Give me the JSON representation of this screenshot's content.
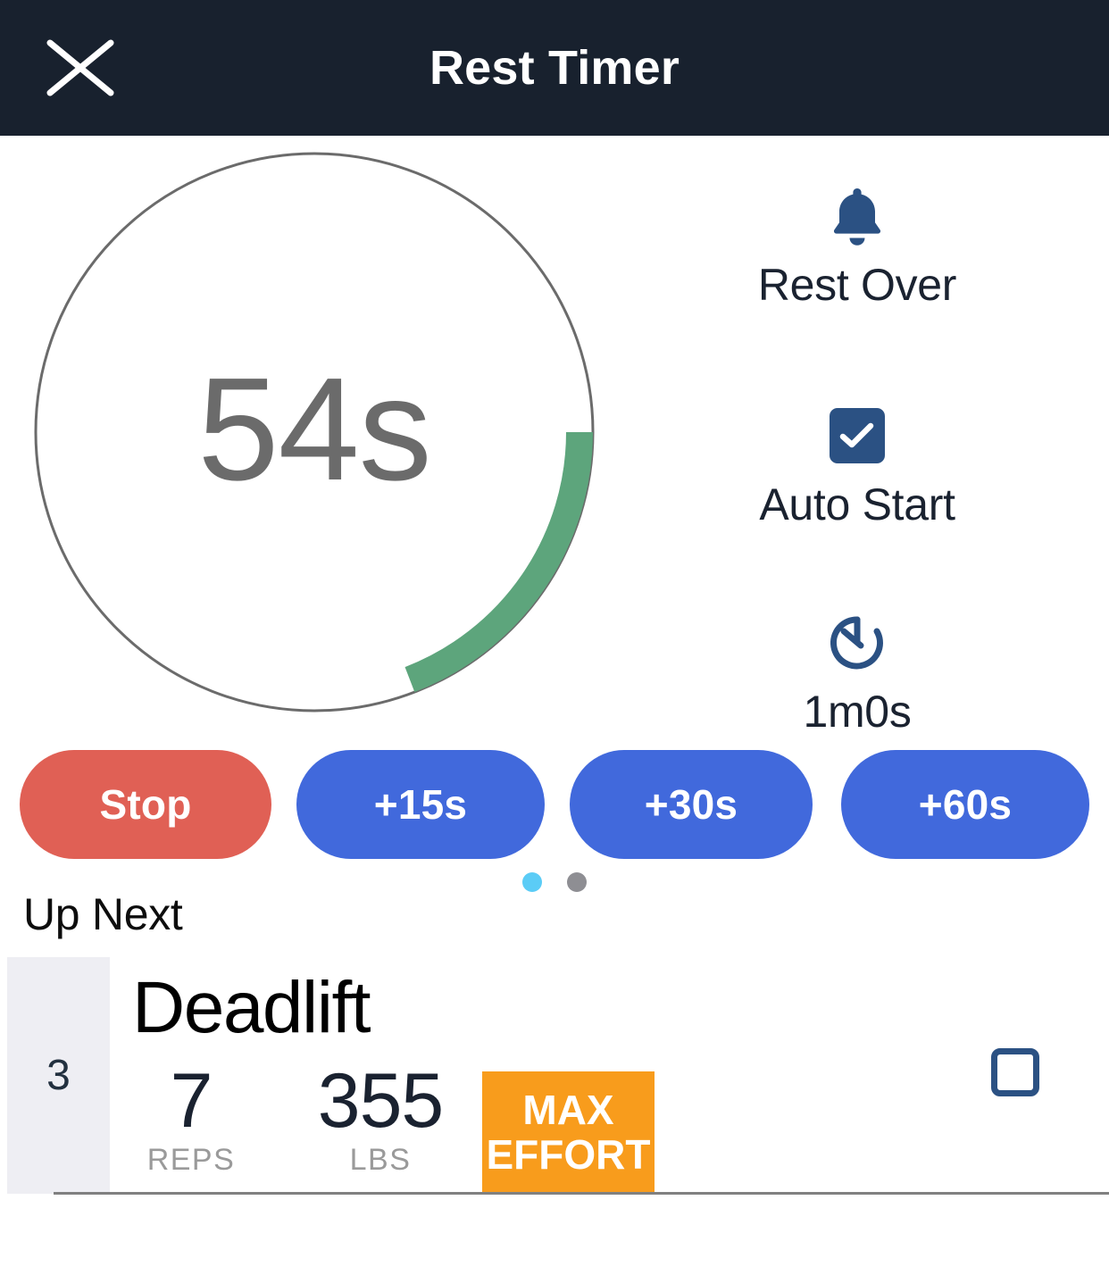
{
  "header": {
    "title": "Rest Timer",
    "close_icon": "close-icon"
  },
  "timer": {
    "remaining_label": "54s",
    "remaining_seconds": 54,
    "total_label": "1m0s",
    "total_seconds": 60,
    "progress_arc_color": "#5da57c",
    "track_color": "#6b6b6b",
    "arc_start_deg": 90,
    "arc_end_deg": 140
  },
  "side_panel": {
    "rest_over": {
      "icon": "bell-icon",
      "label": "Rest Over"
    },
    "auto_start": {
      "icon": "checkbox-checked-icon",
      "label": "Auto Start",
      "checked": true
    },
    "duration": {
      "icon": "stopwatch-icon",
      "label": "1m0s"
    }
  },
  "actions": {
    "buttons": [
      {
        "label": "Stop",
        "color": "#e06055"
      },
      {
        "label": "+15s",
        "color": "#4169dc"
      },
      {
        "label": "+30s",
        "color": "#4169dc"
      },
      {
        "label": "+60s",
        "color": "#4169dc"
      }
    ]
  },
  "pagination": {
    "dots": 2,
    "active_index": 0,
    "active_color": "#5bccf6",
    "inactive_color": "#8e8e93"
  },
  "up_next": {
    "section_label": "Up Next",
    "set": {
      "index": "3",
      "exercise": "Deadlift",
      "metrics": [
        {
          "value": "7",
          "unit": "REPS"
        },
        {
          "value": "355",
          "unit": "LBS"
        }
      ],
      "badge": {
        "line1": "MAX",
        "line2": "EFFORT",
        "color": "#f89c1c"
      },
      "completed": false
    }
  }
}
